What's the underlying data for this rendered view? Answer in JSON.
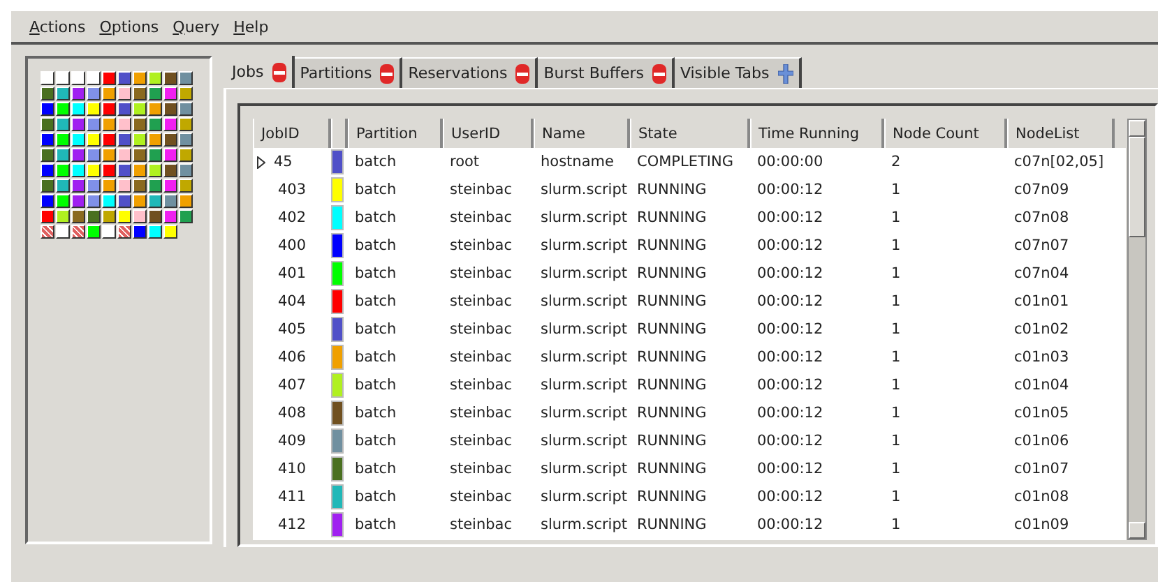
{
  "menu": [
    "Actions",
    "Options",
    "Query",
    "Help"
  ],
  "nodes": [
    {
      "kind": "node",
      "color": "#ffffff"
    },
    {
      "kind": "node",
      "color": "#ffffff"
    },
    {
      "kind": "node",
      "color": "#ffffff"
    },
    {
      "kind": "node",
      "color": "#ffffff"
    },
    {
      "kind": "node",
      "color": "#ff0000"
    },
    {
      "kind": "node",
      "color": "#5050c8"
    },
    {
      "kind": "node",
      "color": "#f0a000"
    },
    {
      "kind": "node",
      "color": "#b0f020"
    },
    {
      "kind": "node",
      "color": "#705020"
    },
    {
      "kind": "node",
      "color": "#7090a0"
    },
    {
      "kind": "node",
      "color": "#4a7020"
    },
    {
      "kind": "node",
      "color": "#20b8b8"
    },
    {
      "kind": "node",
      "color": "#a020f0"
    },
    {
      "kind": "node",
      "color": "#8090e8"
    },
    {
      "kind": "node",
      "color": "#f0a000"
    },
    {
      "kind": "node",
      "color": "#ffc0cb"
    },
    {
      "kind": "node",
      "color": "#8a6a20"
    },
    {
      "kind": "node",
      "color": "#20a050"
    },
    {
      "kind": "node",
      "color": "#f020f0"
    },
    {
      "kind": "node",
      "color": "#c0a800"
    },
    {
      "kind": "node",
      "color": "#0000ff"
    },
    {
      "kind": "node",
      "color": "#00ff00"
    },
    {
      "kind": "node",
      "color": "#00ffff"
    },
    {
      "kind": "node",
      "color": "#ffff00"
    },
    {
      "kind": "node",
      "color": "#ff0000"
    },
    {
      "kind": "node",
      "color": "#5050c8"
    },
    {
      "kind": "node",
      "color": "#b0f020"
    },
    {
      "kind": "node",
      "color": "#f0a000"
    },
    {
      "kind": "node",
      "color": "#705020"
    },
    {
      "kind": "node",
      "color": "#7090a0"
    },
    {
      "kind": "node",
      "color": "#4a7020"
    },
    {
      "kind": "node",
      "color": "#20b8b8"
    },
    {
      "kind": "node",
      "color": "#a020f0"
    },
    {
      "kind": "node",
      "color": "#8090e8"
    },
    {
      "kind": "node",
      "color": "#f0a000"
    },
    {
      "kind": "node",
      "color": "#ffc0cb"
    },
    {
      "kind": "node",
      "color": "#8a6a20"
    },
    {
      "kind": "node",
      "color": "#20a050"
    },
    {
      "kind": "node",
      "color": "#f020f0"
    },
    {
      "kind": "node",
      "color": "#c0a800"
    },
    {
      "kind": "node",
      "color": "#0000ff"
    },
    {
      "kind": "node",
      "color": "#00ff00"
    },
    {
      "kind": "node",
      "color": "#00ffff"
    },
    {
      "kind": "node",
      "color": "#ffff00"
    },
    {
      "kind": "node",
      "color": "#ff0000"
    },
    {
      "kind": "node",
      "color": "#5050c8"
    },
    {
      "kind": "node",
      "color": "#b0f020"
    },
    {
      "kind": "node",
      "color": "#f0a000"
    },
    {
      "kind": "node",
      "color": "#705020"
    },
    {
      "kind": "node",
      "color": "#7090a0"
    },
    {
      "kind": "node",
      "color": "#4a7020"
    },
    {
      "kind": "node",
      "color": "#20b8b8"
    },
    {
      "kind": "node",
      "color": "#a020f0"
    },
    {
      "kind": "node",
      "color": "#8090e8"
    },
    {
      "kind": "node",
      "color": "#f0a000"
    },
    {
      "kind": "node",
      "color": "#ffc0cb"
    },
    {
      "kind": "node",
      "color": "#8a6a20"
    },
    {
      "kind": "node",
      "color": "#20a050"
    },
    {
      "kind": "node",
      "color": "#f020f0"
    },
    {
      "kind": "node",
      "color": "#c0a800"
    },
    {
      "kind": "node",
      "color": "#0000ff"
    },
    {
      "kind": "node",
      "color": "#00ff00"
    },
    {
      "kind": "node",
      "color": "#00ffff"
    },
    {
      "kind": "node",
      "color": "#ffff00"
    },
    {
      "kind": "node",
      "color": "#ff0000"
    },
    {
      "kind": "node",
      "color": "#5050c8"
    },
    {
      "kind": "node",
      "color": "#f0a000"
    },
    {
      "kind": "node",
      "color": "#b0f020"
    },
    {
      "kind": "node",
      "color": "#705020"
    },
    {
      "kind": "node",
      "color": "#7090a0"
    },
    {
      "kind": "node",
      "color": "#4a7020"
    },
    {
      "kind": "node",
      "color": "#20b8b8"
    },
    {
      "kind": "node",
      "color": "#a020f0"
    },
    {
      "kind": "node",
      "color": "#8090e8"
    },
    {
      "kind": "node",
      "color": "#f0a000"
    },
    {
      "kind": "node",
      "color": "#ffc0cb"
    },
    {
      "kind": "node",
      "color": "#8a6a20"
    },
    {
      "kind": "node",
      "color": "#20a050"
    },
    {
      "kind": "node",
      "color": "#f020f0"
    },
    {
      "kind": "node",
      "color": "#c0a800"
    },
    {
      "kind": "node",
      "color": "#0000ff"
    },
    {
      "kind": "node",
      "color": "#00ff00"
    },
    {
      "kind": "node",
      "color": "#a020f0"
    },
    {
      "kind": "node",
      "color": "#8090e8"
    },
    {
      "kind": "node",
      "color": "#00ffff"
    },
    {
      "kind": "node",
      "color": "#5050c8"
    },
    {
      "kind": "node",
      "color": "#f0a000"
    },
    {
      "kind": "node",
      "color": "#20b8b8"
    },
    {
      "kind": "node",
      "color": "#7090a0"
    },
    {
      "kind": "node",
      "color": "#f0a000"
    },
    {
      "kind": "node",
      "color": "#ff0000"
    },
    {
      "kind": "node",
      "color": "#b0f020"
    },
    {
      "kind": "node",
      "color": "#8a6a20"
    },
    {
      "kind": "node",
      "color": "#4a7020"
    },
    {
      "kind": "node",
      "color": "#c0a800"
    },
    {
      "kind": "node",
      "color": "#ffff00"
    },
    {
      "kind": "node",
      "color": "#ffc0cb"
    },
    {
      "kind": "node",
      "color": "#705020"
    },
    {
      "kind": "node",
      "color": "#f020f0"
    },
    {
      "kind": "node",
      "color": "#20a050"
    },
    {
      "kind": "down"
    },
    {
      "kind": "node",
      "color": "#ffffff"
    },
    {
      "kind": "down"
    },
    {
      "kind": "node",
      "color": "#00ff00"
    },
    {
      "kind": "node",
      "color": "#ffffff"
    },
    {
      "kind": "down"
    },
    {
      "kind": "node",
      "color": "#0000ff"
    },
    {
      "kind": "node",
      "color": "#00ffff"
    },
    {
      "kind": "node",
      "color": "#ffff00"
    }
  ],
  "tabs": [
    {
      "label": "Jobs",
      "kind": "closable",
      "selected": true
    },
    {
      "label": "Partitions",
      "kind": "closable",
      "selected": false
    },
    {
      "label": "Reservations",
      "kind": "closable",
      "selected": false
    },
    {
      "label": "Burst Buffers",
      "kind": "closable",
      "selected": false
    },
    {
      "label": "Visible Tabs",
      "kind": "add",
      "selected": false
    }
  ],
  "table": {
    "columns": [
      "JobID",
      "Partition",
      "UserID",
      "Name",
      "State",
      "Time Running",
      "Node Count",
      "NodeList"
    ],
    "rows": [
      {
        "expanded": false,
        "cells": [
          "45",
          "batch",
          "root",
          "hostname",
          "COMPLETING",
          "00:00:00",
          "2",
          "c07n[02,05]"
        ],
        "color": "#5050c8"
      },
      {
        "cells": [
          "403",
          "batch",
          "steinbac",
          "slurm.script",
          "RUNNING",
          "00:00:12",
          "1",
          "c07n09"
        ],
        "color": "#ffff00"
      },
      {
        "cells": [
          "402",
          "batch",
          "steinbac",
          "slurm.script",
          "RUNNING",
          "00:00:12",
          "1",
          "c07n08"
        ],
        "color": "#00ffff"
      },
      {
        "cells": [
          "400",
          "batch",
          "steinbac",
          "slurm.script",
          "RUNNING",
          "00:00:12",
          "1",
          "c07n07"
        ],
        "color": "#0000ff"
      },
      {
        "cells": [
          "401",
          "batch",
          "steinbac",
          "slurm.script",
          "RUNNING",
          "00:00:12",
          "1",
          "c07n04"
        ],
        "color": "#00ff00"
      },
      {
        "cells": [
          "404",
          "batch",
          "steinbac",
          "slurm.script",
          "RUNNING",
          "00:00:12",
          "1",
          "c01n01"
        ],
        "color": "#ff0000"
      },
      {
        "cells": [
          "405",
          "batch",
          "steinbac",
          "slurm.script",
          "RUNNING",
          "00:00:12",
          "1",
          "c01n02"
        ],
        "color": "#5050c8"
      },
      {
        "cells": [
          "406",
          "batch",
          "steinbac",
          "slurm.script",
          "RUNNING",
          "00:00:12",
          "1",
          "c01n03"
        ],
        "color": "#f0a000"
      },
      {
        "cells": [
          "407",
          "batch",
          "steinbac",
          "slurm.script",
          "RUNNING",
          "00:00:12",
          "1",
          "c01n04"
        ],
        "color": "#b0f020"
      },
      {
        "cells": [
          "408",
          "batch",
          "steinbac",
          "slurm.script",
          "RUNNING",
          "00:00:12",
          "1",
          "c01n05"
        ],
        "color": "#705020"
      },
      {
        "cells": [
          "409",
          "batch",
          "steinbac",
          "slurm.script",
          "RUNNING",
          "00:00:12",
          "1",
          "c01n06"
        ],
        "color": "#7090a0"
      },
      {
        "cells": [
          "410",
          "batch",
          "steinbac",
          "slurm.script",
          "RUNNING",
          "00:00:12",
          "1",
          "c01n07"
        ],
        "color": "#4a7020"
      },
      {
        "cells": [
          "411",
          "batch",
          "steinbac",
          "slurm.script",
          "RUNNING",
          "00:00:12",
          "1",
          "c01n08"
        ],
        "color": "#20b8b8"
      },
      {
        "cells": [
          "412",
          "batch",
          "steinbac",
          "slurm.script",
          "RUNNING",
          "00:00:12",
          "1",
          "c01n09"
        ],
        "color": "#a020f0"
      }
    ]
  }
}
